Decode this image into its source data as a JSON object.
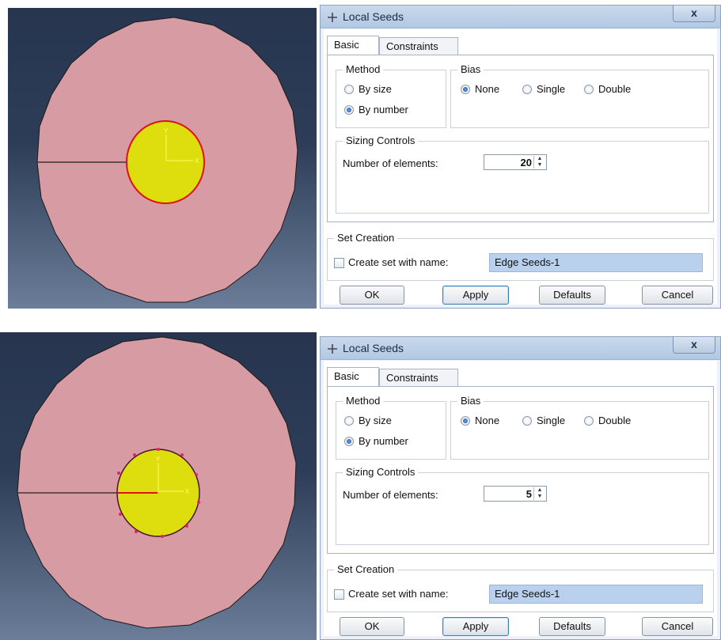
{
  "panels": [
    {
      "viewport": {
        "colors": {
          "outer_disk": "#d79ba3",
          "inner_disk": "#dede0f",
          "axis": "#ffff66",
          "seed": "#e8206c"
        }
      },
      "dialog": {
        "title": "Local Seeds",
        "close_label": "x",
        "tabs": [
          {
            "label": "Basic"
          },
          {
            "label": "Constraints"
          }
        ],
        "method": {
          "title": "Method",
          "options": [
            {
              "label": "By size",
              "selected": false
            },
            {
              "label": "By number",
              "selected": true
            }
          ]
        },
        "bias": {
          "title": "Bias",
          "options": [
            {
              "label": "None",
              "selected": true
            },
            {
              "label": "Single",
              "selected": false
            },
            {
              "label": "Double",
              "selected": false
            }
          ]
        },
        "sizing": {
          "title": "Sizing Controls",
          "label": "Number of elements:",
          "value": "20"
        },
        "set_creation": {
          "title": "Set Creation",
          "checkbox_label": "Create set with name:",
          "name_value": "Edge Seeds-1"
        },
        "buttons": {
          "ok": "OK",
          "apply": "Apply",
          "defaults": "Defaults",
          "cancel": "Cancel"
        }
      }
    },
    {
      "viewport": {
        "colors": {
          "outer_disk": "#d79ba3",
          "inner_disk": "#dede0f",
          "axis": "#ffff66",
          "seed": "#e8206c"
        }
      },
      "dialog": {
        "title": "Local Seeds",
        "close_label": "x",
        "tabs": [
          {
            "label": "Basic"
          },
          {
            "label": "Constraints"
          }
        ],
        "method": {
          "title": "Method",
          "options": [
            {
              "label": "By size",
              "selected": false
            },
            {
              "label": "By number",
              "selected": true
            }
          ]
        },
        "bias": {
          "title": "Bias",
          "options": [
            {
              "label": "None",
              "selected": true
            },
            {
              "label": "Single",
              "selected": false
            },
            {
              "label": "Double",
              "selected": false
            }
          ]
        },
        "sizing": {
          "title": "Sizing Controls",
          "label": "Number of elements:",
          "value": "5"
        },
        "set_creation": {
          "title": "Set Creation",
          "checkbox_label": "Create set with name:",
          "name_value": "Edge Seeds-1"
        },
        "buttons": {
          "ok": "OK",
          "apply": "Apply",
          "defaults": "Defaults",
          "cancel": "Cancel"
        }
      }
    }
  ]
}
